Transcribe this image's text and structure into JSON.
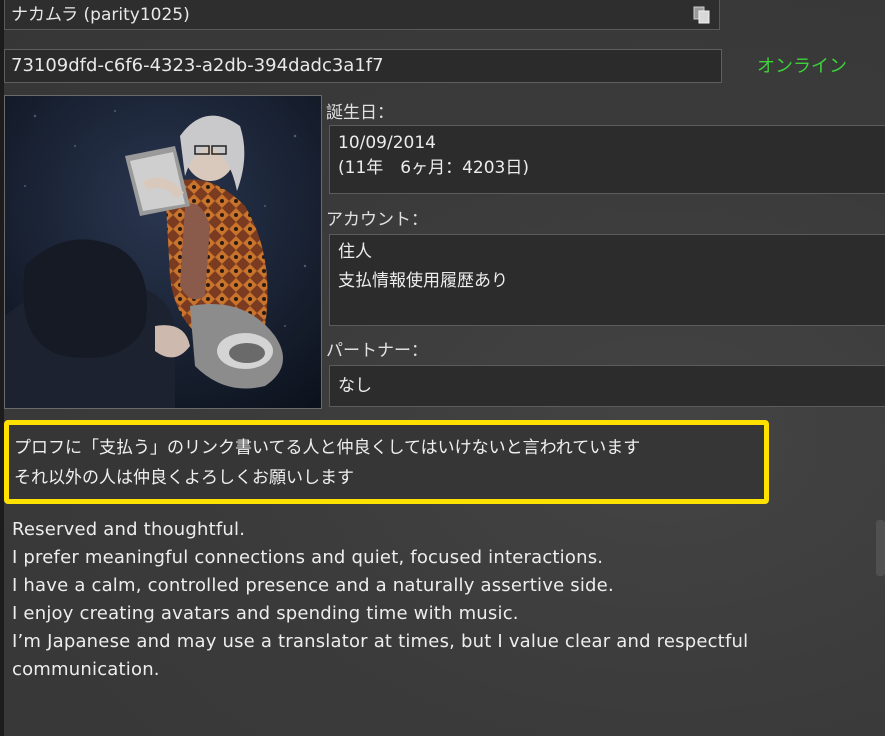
{
  "profile": {
    "display_name": "ナカムラ (parity1025)",
    "uuid": "73109dfd-c6f6-4323-a2db-394dadc3a1f7",
    "status": "オンライン",
    "status_color": "#3ed13a"
  },
  "fields": {
    "birthday_label": "誕生日：",
    "birthday_date": "10/09/2014",
    "birthday_age": "(11年　6ヶ月：4203日)",
    "account_label": "アカウント：",
    "account_type": "住人",
    "account_payment": "支払情報使用履歴あり",
    "partner_label": "パートナー：",
    "partner_value": "なし"
  },
  "about": {
    "highlight_color": "#ffe100",
    "jp_lines": [
      "プロフに「支払う」のリンク書いてる人と仲良くしてはいけないと言われています",
      "それ以外の人は仲良くよろしくお願いします"
    ],
    "en_lines": [
      "Reserved and thoughtful.",
      "I prefer meaningful connections and quiet, focused interactions.",
      "I have a calm, controlled presence and a naturally assertive side.",
      "I enjoy creating avatars and spending time with music.",
      "I’m Japanese and may use a translator at times, but I value clear and respectful",
      "communication."
    ]
  },
  "icons": {
    "copy": "copy-icon",
    "avatar": "profile-picture"
  }
}
